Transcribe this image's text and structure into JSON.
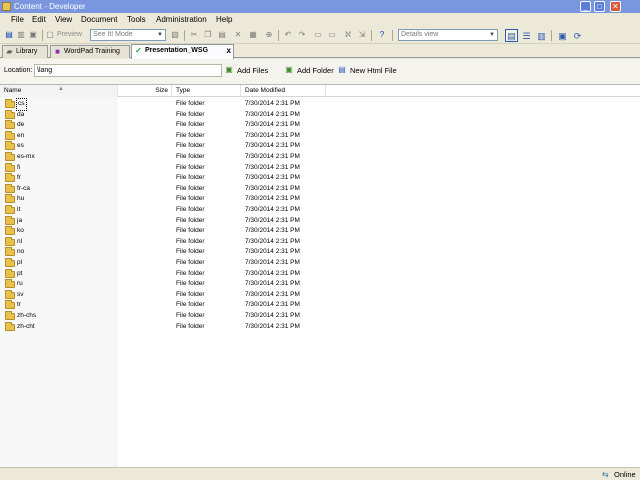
{
  "window": {
    "title": "Content - Developer"
  },
  "menu": [
    "File",
    "Edit",
    "View",
    "Document",
    "Tools",
    "Administration",
    "Help"
  ],
  "toolbar": {
    "preview_label": "Preview",
    "mode_select": "See It! Mode",
    "view_select": "Details view"
  },
  "tabs": [
    {
      "label": "Library",
      "icon": "library-icon"
    },
    {
      "label": "WordPad Training",
      "icon": "document-icon"
    },
    {
      "label": "Presentation_WSG",
      "icon": "checkmark-icon",
      "close": "x"
    }
  ],
  "location": {
    "label": "Location:",
    "value": "\\lang",
    "actions": [
      "Add Files",
      "Add Folder",
      "New Html File"
    ]
  },
  "columns": {
    "name": "Name",
    "size": "Size",
    "type": "Type",
    "date": "Date Modified"
  },
  "rows": [
    {
      "name": "cs",
      "type": "File folder",
      "date": "7/30/2014 2:31 PM"
    },
    {
      "name": "da",
      "type": "File folder",
      "date": "7/30/2014 2:31 PM"
    },
    {
      "name": "de",
      "type": "File folder",
      "date": "7/30/2014 2:31 PM"
    },
    {
      "name": "en",
      "type": "File folder",
      "date": "7/30/2014 2:31 PM"
    },
    {
      "name": "es",
      "type": "File folder",
      "date": "7/30/2014 2:31 PM"
    },
    {
      "name": "es-mx",
      "type": "File folder",
      "date": "7/30/2014 2:31 PM"
    },
    {
      "name": "fi",
      "type": "File folder",
      "date": "7/30/2014 2:31 PM"
    },
    {
      "name": "fr",
      "type": "File folder",
      "date": "7/30/2014 2:31 PM"
    },
    {
      "name": "fr-ca",
      "type": "File folder",
      "date": "7/30/2014 2:31 PM"
    },
    {
      "name": "hu",
      "type": "File folder",
      "date": "7/30/2014 2:31 PM"
    },
    {
      "name": "it",
      "type": "File folder",
      "date": "7/30/2014 2:31 PM"
    },
    {
      "name": "ja",
      "type": "File folder",
      "date": "7/30/2014 2:31 PM"
    },
    {
      "name": "ko",
      "type": "File folder",
      "date": "7/30/2014 2:31 PM"
    },
    {
      "name": "nl",
      "type": "File folder",
      "date": "7/30/2014 2:31 PM"
    },
    {
      "name": "no",
      "type": "File folder",
      "date": "7/30/2014 2:31 PM"
    },
    {
      "name": "pl",
      "type": "File folder",
      "date": "7/30/2014 2:31 PM"
    },
    {
      "name": "pt",
      "type": "File folder",
      "date": "7/30/2014 2:31 PM"
    },
    {
      "name": "ru",
      "type": "File folder",
      "date": "7/30/2014 2:31 PM"
    },
    {
      "name": "sv",
      "type": "File folder",
      "date": "7/30/2014 2:31 PM"
    },
    {
      "name": "tr",
      "type": "File folder",
      "date": "7/30/2014 2:31 PM"
    },
    {
      "name": "zh-chs",
      "type": "File folder",
      "date": "7/30/2014 2:31 PM"
    },
    {
      "name": "zh-cht",
      "type": "File folder",
      "date": "7/30/2014 2:31 PM"
    }
  ],
  "status": {
    "text": "Online",
    "icon": "network-icon"
  }
}
